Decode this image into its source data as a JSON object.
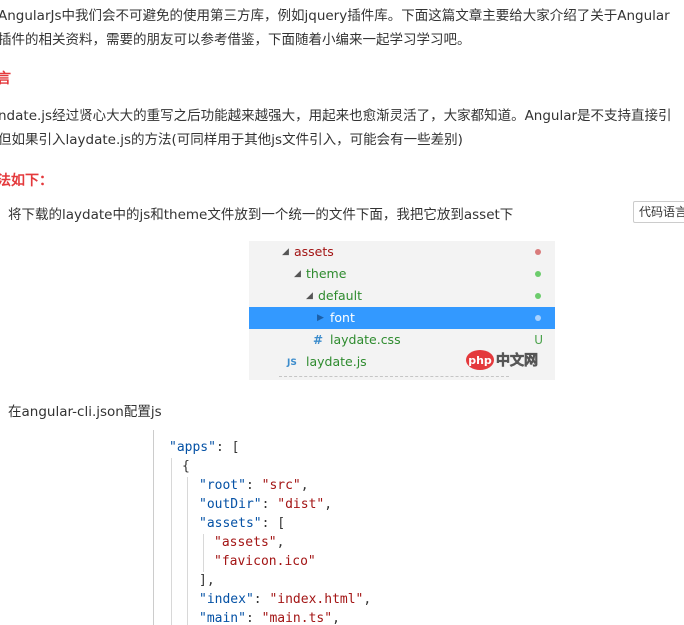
{
  "article": {
    "intro_line1": "AngularJs中我们会不可避免的使用第三方库，例如jquery插件库。下面这篇文章主要给大家介绍了关于Angular",
    "intro_line2": "插件的相关资料，需要的朋友可以参考借鉴，下面随着小编来一起学习学习吧。",
    "heading_preface": "言",
    "body_line1": "ndate.js经过贤心大大的重写之后功能越来越强大，用起来也愈渐灵活了，大家都知道。Angular是不支持直接引",
    "body_line2": "但如果引入laydate.js的方法(可同样用于其他js文件引入，可能会有一些差别)",
    "heading_method": "法如下：",
    "step1": "将下载的laydate中的js和theme文件放到一个统一的文件下面，我把它放到asset下",
    "step2": "在angular-cli.json配置js",
    "code_lang_button": "代码语言"
  },
  "file_tree": {
    "items": [
      {
        "label": "assets",
        "color": "#a31515",
        "status_color": "#d97b7b"
      },
      {
        "label": "theme",
        "color": "#2e8b2e",
        "status_color": "#6ccc6c"
      },
      {
        "label": "default",
        "color": "#2e8b2e",
        "status_color": "#6ccc6c"
      },
      {
        "label": "font",
        "color": "#ffffff",
        "status_color": "#a9d2ff"
      },
      {
        "label": "laydate.css",
        "color": "#2e8b2e",
        "status": "U",
        "icon": "#"
      },
      {
        "label": "laydate.js",
        "color": "#2e8b2e",
        "icon": "JS"
      }
    ],
    "selected_color": "#3399ff"
  },
  "watermark": {
    "brand": "php",
    "suffix": "中文网",
    "brand_color": "#e4393c"
  },
  "code": {
    "lines": [
      "\"apps\": [",
      "{",
      "\"root\": \"src\",",
      "\"outDir\": \"dist\",",
      "\"assets\": [",
      "\"assets\",",
      "\"favicon.ico\"",
      "],",
      "\"index\": \"index.html\",",
      "\"main\": \"main.ts\","
    ]
  }
}
